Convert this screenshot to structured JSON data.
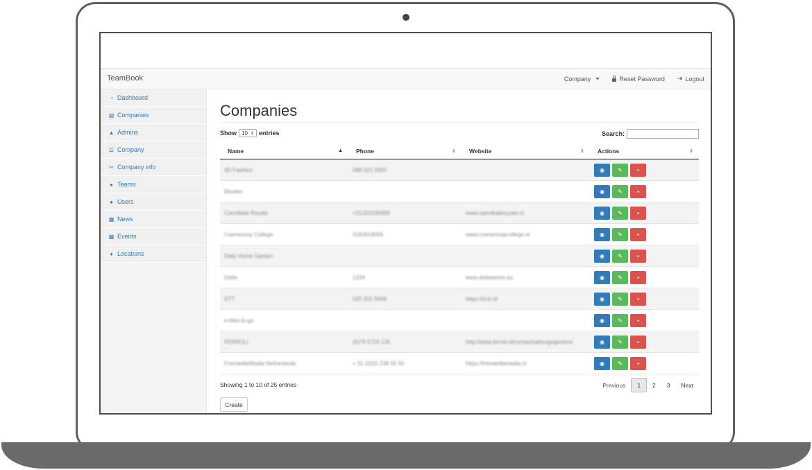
{
  "navbar": {
    "brand": "TeamBook",
    "company_label": "Company",
    "reset_password": "Reset Password",
    "logout": "Logout"
  },
  "sidebar": {
    "items": [
      {
        "label": "Dashboard",
        "icon": "dashboard-icon",
        "glyph": "◔"
      },
      {
        "label": "Companies",
        "icon": "building-icon",
        "glyph": "▤"
      },
      {
        "label": "Admins",
        "icon": "lock-icon",
        "glyph": "▲"
      },
      {
        "label": "Company",
        "icon": "sliders-icon",
        "glyph": "☰"
      },
      {
        "label": "Company info",
        "icon": "scissors-icon",
        "glyph": "✂"
      },
      {
        "label": "Teams",
        "icon": "group-icon",
        "glyph": "●"
      },
      {
        "label": "Users",
        "icon": "user-icon",
        "glyph": "●"
      },
      {
        "label": "News",
        "icon": "file-icon",
        "glyph": "▦"
      },
      {
        "label": "Events",
        "icon": "calendar-icon",
        "glyph": "▦"
      },
      {
        "label": "Locations",
        "icon": "map-marker-icon",
        "glyph": "♦"
      }
    ]
  },
  "main": {
    "title": "Companies",
    "length": {
      "show": "Show",
      "value": "10",
      "entries": "entries"
    },
    "search_label": "Search:",
    "columns": [
      "Name",
      "Phone",
      "Website",
      "Actions"
    ],
    "rows": [
      {
        "name": "3D Fashion",
        "phone": "088 022 3300",
        "website": ""
      },
      {
        "name": "Bloolen",
        "phone": "",
        "website": ""
      },
      {
        "name": "Cannibale Royale",
        "phone": "+31202335883",
        "website": "www.cannibaleroyale.nl"
      },
      {
        "name": "Coenecoop College",
        "phone": "0182618055",
        "website": "www.coenecoopcollege.nl"
      },
      {
        "name": "Daily Home Garden",
        "phone": "",
        "website": ""
      },
      {
        "name": "Delta",
        "phone": "1234",
        "website": "www.deltawines.eu"
      },
      {
        "name": "DTT",
        "phone": "020 331 5848",
        "website": "https://d-tt.nl/"
      },
      {
        "name": "e-bike-to-go",
        "phone": "",
        "website": ""
      },
      {
        "name": "FERROLI",
        "phone": "(0)76 5720 135",
        "website": "http://www.ferroli.nl/contact/adresgegevens/"
      },
      {
        "name": "FremantleMedia Netherlands",
        "phone": "+ 31 (0)20 236 55 55",
        "website": "https://fremantlemedia.nl"
      }
    ],
    "info": "Showing 1 to 10 of 25 entries",
    "pagination": {
      "previous": "Previous",
      "pages": [
        "1",
        "2",
        "3"
      ],
      "next": "Next"
    },
    "create_label": "Create"
  },
  "colors": {
    "view": "#337ab7",
    "edit": "#5cb85c",
    "delete": "#d9534f",
    "link": "#337ab7"
  }
}
